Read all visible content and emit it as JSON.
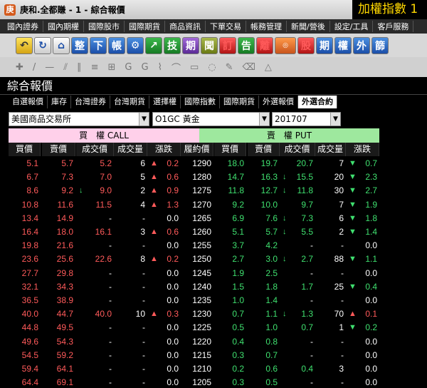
{
  "window": {
    "title": "庚和.全都賺 - 1 - 綜合報價",
    "ticker": "加權指數  1"
  },
  "menu": [
    "國內證券",
    "國內期權",
    "國際股市",
    "國際期貨",
    "商品資訊",
    "下單交易",
    "帳務管理",
    "新聞/營後",
    "設定/工具",
    "客戶服務"
  ],
  "toolbar_labels": [
    "整",
    "下",
    "帳",
    "技",
    "期",
    "聞",
    "訂",
    "告",
    "離",
    "股",
    "期",
    "權",
    "外",
    "篩"
  ],
  "panel_title": "綜合報價",
  "tabs": [
    "自選報價",
    "庫存",
    "台灣證券",
    "台灣期貨",
    "選擇權",
    "國際指數",
    "國際期貨",
    "外選報價",
    "外選合約"
  ],
  "active_tab": "外選合約",
  "filters": {
    "exchange": "美國商品交易所",
    "product": "O1GC 黃金",
    "month": "201707"
  },
  "sections": {
    "call": "買　權 CALL",
    "put": "賣　權 PUT"
  },
  "columns": [
    "買價",
    "賣價",
    "成交價",
    "成交量",
    "漲跌",
    "履約價",
    "買價",
    "賣價",
    "成交價",
    "成交量",
    "漲跌"
  ],
  "rows": [
    {
      "cb": "5.1",
      "cs": "5.7",
      "ct": "5.2",
      "cv": "6",
      "cd": "0.2",
      "cdir": "up",
      "strike": "1290",
      "pb": "18.0",
      "ps": "19.7",
      "pt": "20.7",
      "pv": "7",
      "pd": "0.7",
      "pdir": "down"
    },
    {
      "cb": "6.7",
      "cs": "7.3",
      "ct": "7.0",
      "cv": "5",
      "cd": "0.6",
      "cdir": "up",
      "strike": "1280",
      "pb": "14.7",
      "ps": "16.3",
      "pt": "15.5",
      "ptarr": "down",
      "pv": "20",
      "pd": "2.3",
      "pdir": "down"
    },
    {
      "cb": "8.6",
      "cs": "9.2",
      "ct": "9.0",
      "ctarr": "down",
      "cv": "2",
      "cd": "0.9",
      "cdir": "up",
      "strike": "1275",
      "pb": "11.8",
      "ps": "12.7",
      "pt": "11.8",
      "ptarr": "down",
      "pv": "30",
      "pd": "2.7",
      "pdir": "down"
    },
    {
      "cb": "10.8",
      "cs": "11.6",
      "ct": "11.5",
      "cv": "4",
      "cd": "1.3",
      "cdir": "up",
      "strike": "1270",
      "pb": "9.2",
      "ps": "10.0",
      "pt": "9.7",
      "pv": "7",
      "pd": "1.9",
      "pdir": "down"
    },
    {
      "cb": "13.4",
      "cs": "14.9",
      "ct": "-",
      "cv": "-",
      "cd": "0.0",
      "cdir": "none",
      "strike": "1265",
      "pb": "6.9",
      "ps": "7.6",
      "pt": "7.3",
      "ptarr": "down",
      "pv": "6",
      "pd": "1.8",
      "pdir": "down"
    },
    {
      "cb": "16.4",
      "cs": "18.0",
      "ct": "16.1",
      "cv": "3",
      "cd": "0.6",
      "cdir": "up",
      "strike": "1260",
      "pb": "5.1",
      "ps": "5.7",
      "pt": "5.5",
      "ptarr": "down",
      "pv": "2",
      "pd": "1.4",
      "pdir": "down"
    },
    {
      "cb": "19.8",
      "cs": "21.6",
      "ct": "-",
      "cv": "-",
      "cd": "0.0",
      "cdir": "none",
      "strike": "1255",
      "pb": "3.7",
      "ps": "4.2",
      "pt": "-",
      "pv": "-",
      "pd": "0.0",
      "pdir": "none"
    },
    {
      "cb": "23.6",
      "cs": "25.6",
      "ct": "22.6",
      "cv": "8",
      "cd": "0.2",
      "cdir": "up",
      "strike": "1250",
      "pb": "2.7",
      "ps": "3.0",
      "pt": "2.7",
      "ptarr": "down",
      "pv": "88",
      "pd": "1.1",
      "pdir": "down"
    },
    {
      "cb": "27.7",
      "cs": "29.8",
      "ct": "-",
      "cv": "-",
      "cd": "0.0",
      "cdir": "none",
      "strike": "1245",
      "pb": "1.9",
      "ps": "2.5",
      "pt": "-",
      "pv": "-",
      "pd": "0.0",
      "pdir": "none"
    },
    {
      "cb": "32.1",
      "cs": "34.3",
      "ct": "-",
      "cv": "-",
      "cd": "0.0",
      "cdir": "none",
      "strike": "1240",
      "pb": "1.5",
      "ps": "1.8",
      "pt": "1.7",
      "pv": "25",
      "pd": "0.4",
      "pdir": "down"
    },
    {
      "cb": "36.5",
      "cs": "38.9",
      "ct": "-",
      "cv": "-",
      "cd": "0.0",
      "cdir": "none",
      "strike": "1235",
      "pb": "1.0",
      "ps": "1.4",
      "pt": "-",
      "pv": "-",
      "pd": "0.0",
      "pdir": "none"
    },
    {
      "cb": "40.0",
      "cs": "44.7",
      "ct": "40.0",
      "cv": "10",
      "cd": "0.3",
      "cdir": "up",
      "strike": "1230",
      "pb": "0.7",
      "ps": "1.1",
      "pt": "1.3",
      "ptarr": "down",
      "pv": "70",
      "pd": "0.1",
      "pdir": "up"
    },
    {
      "cb": "44.8",
      "cs": "49.5",
      "ct": "-",
      "cv": "-",
      "cd": "0.0",
      "cdir": "none",
      "strike": "1225",
      "pb": "0.5",
      "ps": "1.0",
      "pt": "0.7",
      "pv": "1",
      "pd": "0.2",
      "pdir": "down"
    },
    {
      "cb": "49.6",
      "cs": "54.3",
      "ct": "-",
      "cv": "-",
      "cd": "0.0",
      "cdir": "none",
      "strike": "1220",
      "pb": "0.4",
      "ps": "0.8",
      "pt": "-",
      "pv": "-",
      "pd": "0.0",
      "pdir": "none"
    },
    {
      "cb": "54.5",
      "cs": "59.2",
      "ct": "-",
      "cv": "-",
      "cd": "0.0",
      "cdir": "none",
      "strike": "1215",
      "pb": "0.3",
      "ps": "0.7",
      "pt": "-",
      "pv": "-",
      "pd": "0.0",
      "pdir": "none"
    },
    {
      "cb": "59.4",
      "cs": "64.1",
      "ct": "-",
      "cv": "-",
      "cd": "0.0",
      "cdir": "none",
      "strike": "1210",
      "pb": "0.2",
      "ps": "0.6",
      "pt": "0.4",
      "pv": "3",
      "pd": "0.0",
      "pdir": "none"
    },
    {
      "cb": "64.4",
      "cs": "69.1",
      "ct": "-",
      "cv": "-",
      "cd": "0.0",
      "cdir": "none",
      "strike": "1205",
      "pb": "0.3",
      "ps": "0.5",
      "pt": "-",
      "pv": "-",
      "pd": "0.0",
      "pdir": "none"
    }
  ],
  "colors": {
    "up": "#ff5a5a",
    "down": "#3fe06f",
    "flat": "#ffffff",
    "call_header_bg": "#ffd0ea",
    "put_header_bg": "#9ee89e",
    "ticker": "#ffd800"
  }
}
